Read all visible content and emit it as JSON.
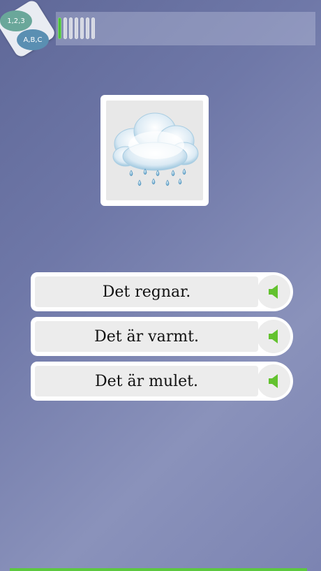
{
  "header": {
    "logo": {
      "numbers_label": "1,2,3",
      "letters_label": "A,B,C"
    },
    "progress": {
      "completed": 1,
      "total": 7
    }
  },
  "question": {
    "image_icon": "rain-cloud-icon"
  },
  "answers": [
    {
      "label": "Det regnar.",
      "speaker_icon": "speaker-icon"
    },
    {
      "label": "Det är varmt.",
      "speaker_icon": "speaker-icon"
    },
    {
      "label": "Det är mulet.",
      "speaker_icon": "speaker-icon"
    }
  ],
  "colors": {
    "accent_green": "#4cc23a",
    "speaker_green": "#63c22f",
    "background": "#6f78a8"
  }
}
